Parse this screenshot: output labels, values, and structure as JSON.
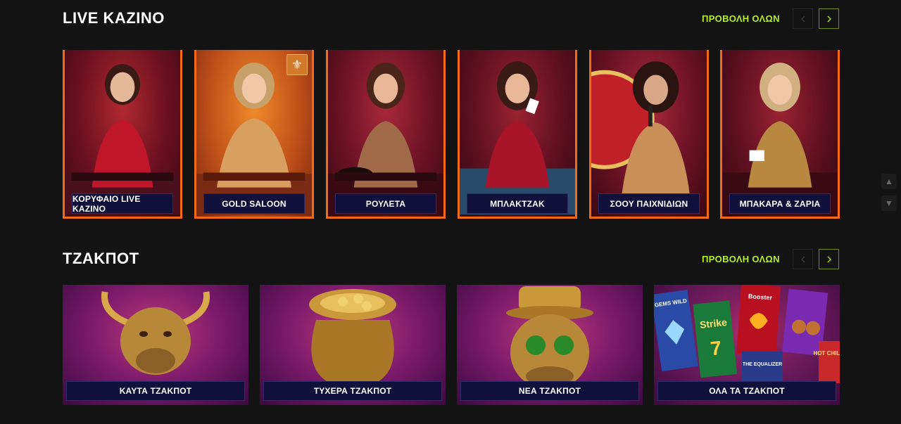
{
  "live_section": {
    "title": "LIVE KAZINO",
    "view_all": "ΠΡΟΒΟΛΗ ΟΛΩΝ",
    "cards": [
      {
        "label": "ΚΟΡΥΦΑΙΟ LIVE KAZINO"
      },
      {
        "label": "GOLD SALOON"
      },
      {
        "label": "ΡΟΥΛΕΤΑ"
      },
      {
        "label": "ΜΠΛΑΚΤΖΑΚ"
      },
      {
        "label": "ΣΟΟΥ ΠΑΙΧΝΙΔΙΩΝ"
      },
      {
        "label": "ΜΠΑΚΑΡΑ & ΖΑΡΙΑ"
      }
    ]
  },
  "jackpot_section": {
    "title": "ΤΖΑΚΠΟΤ",
    "view_all": "ΠΡΟΒΟΛΗ ΟΛΩΝ",
    "cards": [
      {
        "label": "ΚΑΥΤΑ ΤΖΑΚΠΟΤ"
      },
      {
        "label": "ΤΥΧΕΡΑ ΤΖΑΚΠΟΤ"
      },
      {
        "label": "ΝΕΑ ΤΖΑΚΠΟΤ"
      },
      {
        "label": "ΟΛΑ ΤΑ ΤΖΑΚΠΟΤ"
      }
    ]
  },
  "slot_thumbs": {
    "gems": "GEMS WILD",
    "strike": "Strike",
    "booster": "Booster",
    "equalizer": "THE EQUALIZER",
    "hot": "HOT CHILLI"
  },
  "colors": {
    "accent": "#b6ef1f",
    "card_border": "#f26a15",
    "label_bg": "#10103a",
    "background": "#131313"
  },
  "icons": {
    "prev": "chevron-left-icon",
    "next": "chevron-right-icon",
    "badge": "fleur-de-lis-icon",
    "scroll_up": "arrow-up-icon",
    "scroll_down": "arrow-down-icon"
  }
}
